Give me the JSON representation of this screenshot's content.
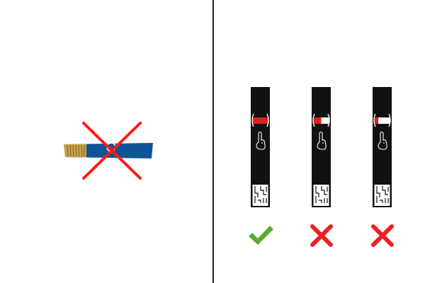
{
  "colors": {
    "background": "#ffffff",
    "divider": "#222222",
    "strip_body": "#111111",
    "blue_strip": "#0f5596",
    "gold_contacts": "#c8a24a",
    "red_band": "#e02020",
    "wrong_cross": "#ee1f24",
    "check_green": "#5aac2c",
    "big_x": "#ff1a1a"
  },
  "left": {
    "icon": "blue-test-strip-icon",
    "overlay_icon": "red-cross-icon"
  },
  "right": {
    "strips": [
      {
        "id": "strip-correct",
        "icon": "test-strip-icon",
        "red_fill": 1.0,
        "result_icon": "green-check-icon"
      },
      {
        "id": "strip-wrong-a",
        "icon": "test-strip-icon",
        "red_fill": 0.5,
        "result_icon": "red-x-icon"
      },
      {
        "id": "strip-wrong-b",
        "icon": "test-strip-icon",
        "red_fill": 0.25,
        "result_icon": "red-x-icon"
      }
    ]
  }
}
